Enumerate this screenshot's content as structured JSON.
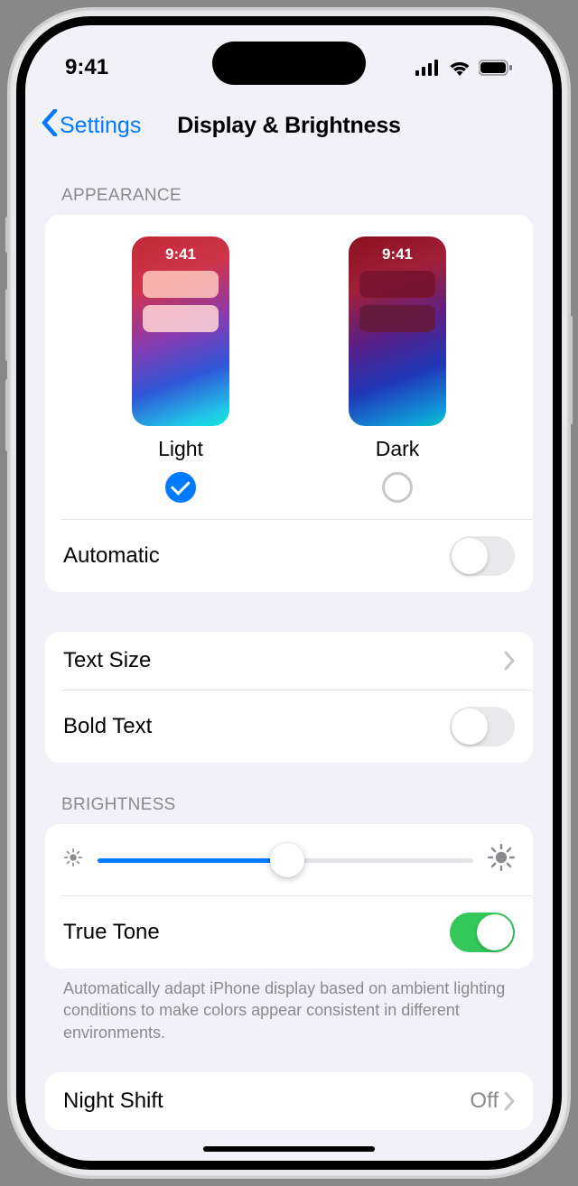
{
  "statusbar": {
    "time": "9:41"
  },
  "nav": {
    "back": "Settings",
    "title": "Display & Brightness"
  },
  "appearance": {
    "header": "APPEARANCE",
    "options": [
      {
        "label": "Light",
        "time": "9:41",
        "selected": true
      },
      {
        "label": "Dark",
        "time": "9:41",
        "selected": false
      }
    ],
    "automatic": {
      "label": "Automatic",
      "on": false
    }
  },
  "text": {
    "textSize": {
      "label": "Text Size"
    },
    "boldText": {
      "label": "Bold Text",
      "on": false
    }
  },
  "brightness": {
    "header": "BRIGHTNESS",
    "value_pct": 48,
    "trueTone": {
      "label": "True Tone",
      "on": true
    },
    "footnote": "Automatically adapt iPhone display based on ambient lighting conditions to make colors appear consistent in different environments."
  },
  "nightShift": {
    "label": "Night Shift",
    "value": "Off"
  }
}
